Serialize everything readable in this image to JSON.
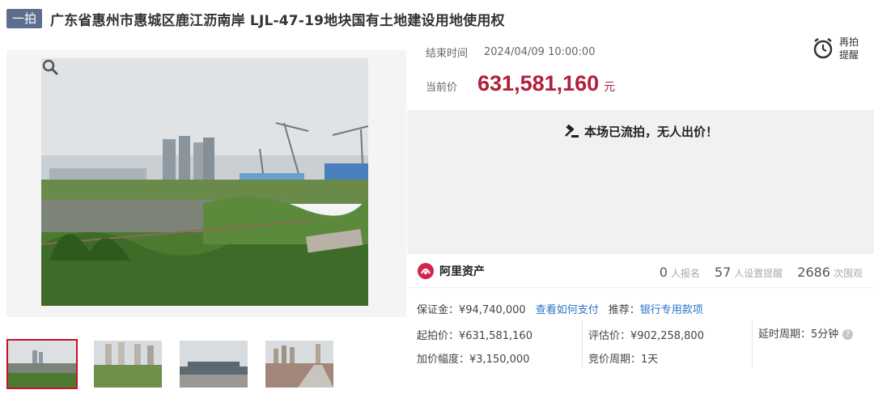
{
  "header": {
    "round_badge": "一拍",
    "title": "广东省惠州市惠城区鹿江沥南岸 LJL-47-19地块国有土地建设用地使用权"
  },
  "auction": {
    "end_label": "结束时间",
    "end_value": "2024/04/09 10:00:00",
    "price_label": "当前价",
    "price_value": "631,581,160",
    "price_unit": "元",
    "remind_label": "再拍提醒",
    "status_message": "本场已流拍，无人出价！"
  },
  "platform": {
    "name": "阿里资产",
    "signups_count": "0",
    "signups_label": "人报名",
    "reminders_count": "57",
    "reminders_label": "人设置提醒",
    "views_count": "2686",
    "views_label": "次围观"
  },
  "details": {
    "deposit": "保证金：¥94,740,000",
    "payment_link": "查看如何支付",
    "recommend_label": "推荐：",
    "recommend_link": "银行专用款项",
    "start_price": "起拍价：¥631,581,160",
    "appraisal": "评估价：¥902,258,800",
    "delay_period": "延时周期：5分钟",
    "increment": "加价幅度：¥3,150,000",
    "bid_cycle": "竞价周期：1天"
  },
  "icons": {
    "zoom": "magnifier-icon",
    "clock": "alarm-clock-icon",
    "gavel": "gavel-icon",
    "platform_logo": "ali-asset-logo-icon",
    "help": "question-icon"
  },
  "colors": {
    "price": "#b1203a",
    "badge": "#5d6f8f",
    "link": "#2a73c9",
    "active_thumb": "#c8102e"
  }
}
